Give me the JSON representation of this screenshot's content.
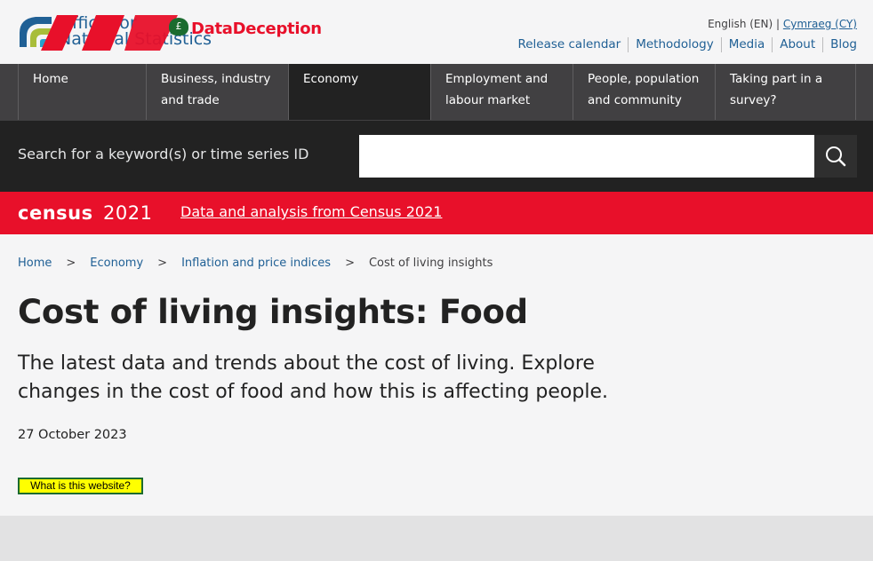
{
  "header": {
    "logo_line1": "Office for",
    "logo_line2": "National Statistics",
    "brand_symbol": "£",
    "brand": "DataDeception",
    "lang_current": "English (EN) |",
    "lang_alt": "Cymraeg (CY)",
    "util_links": [
      "Release calendar",
      "Methodology",
      "Media",
      "About",
      "Blog"
    ]
  },
  "nav": {
    "items": [
      "Home",
      "Business, industry and trade",
      "Economy",
      "Employment and labour market",
      "People, population and community",
      "Taking part in a survey?"
    ],
    "active": "Economy"
  },
  "search": {
    "label": "Search for a keyword(s) or time series ID",
    "value": ""
  },
  "census": {
    "logo_text": "census 2021",
    "link": "Data and analysis from Census 2021"
  },
  "breadcrumb": {
    "items": [
      "Home",
      "Economy",
      "Inflation and price indices"
    ],
    "separator": ">",
    "current": "Cost of living insights"
  },
  "page": {
    "title": "Cost of living insights: Food",
    "lede": "The latest data and trends about the cost of living. Explore changes in the cost of food and how this is affecting people.",
    "date": "27 October 2023",
    "what_button": "What is this website?"
  },
  "colors": {
    "brand_blue": "#206095",
    "brand_red": "#e8102a",
    "nav_bg": "#414042",
    "search_bg": "#222222",
    "badge_yellow": "#ffff00"
  }
}
